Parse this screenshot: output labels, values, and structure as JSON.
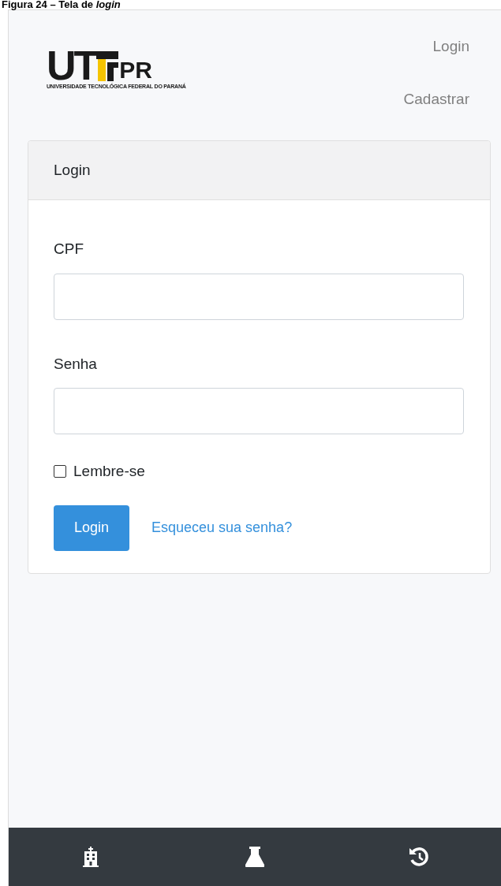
{
  "caption": {
    "text": "Figura 24 – Tela de *login*"
  },
  "logo": {
    "left": "UT",
    "right": "PR",
    "subtitle": "UNIVERSIDADE TECNOLÓGICA FEDERAL DO PARANÁ"
  },
  "nav": [
    {
      "label": "Login"
    },
    {
      "label": "Cadastrar"
    }
  ],
  "card": {
    "title": "Login",
    "fields": [
      {
        "label": "CPF"
      },
      {
        "label": "Senha"
      }
    ],
    "remember": {
      "label": "Lembre-se",
      "checked": false
    },
    "button": "Login",
    "link": "Esqueceu sua senha?"
  },
  "bottom_bar": [
    {
      "kind": "building"
    },
    {
      "kind": "flask"
    },
    {
      "kind": "history"
    }
  ]
}
